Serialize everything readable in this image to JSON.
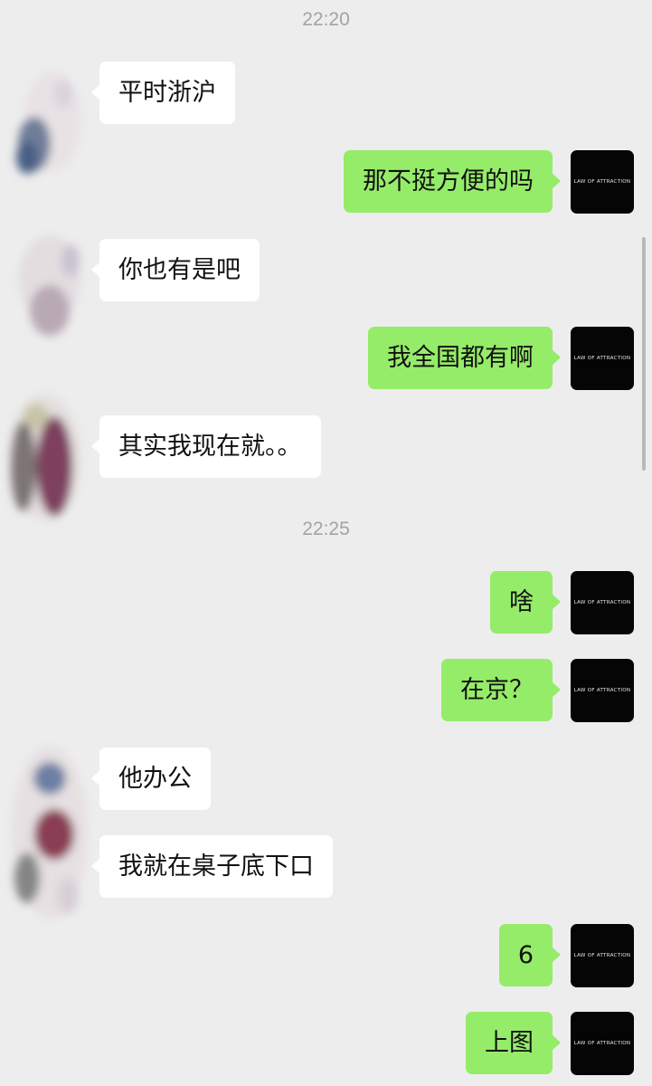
{
  "timestamps": [
    "22:20",
    "22:25"
  ],
  "messages": [
    {
      "side": "left",
      "text": "平时浙沪"
    },
    {
      "side": "right",
      "text": "那不挺方便的吗"
    },
    {
      "side": "left",
      "text": "你也有是吧"
    },
    {
      "side": "right",
      "text": "我全国都有啊"
    },
    {
      "side": "left",
      "text": "其实我现在就。。"
    },
    {
      "side": "right",
      "text": "啥"
    },
    {
      "side": "right",
      "text": "在京？"
    },
    {
      "side": "left",
      "text": "他办公"
    },
    {
      "side": "left",
      "text": "我就在桌子底下口"
    },
    {
      "side": "right",
      "text": "6"
    },
    {
      "side": "right",
      "text": "上图"
    }
  ],
  "my_avatar_text": "LAW OF ATTRACTION",
  "colors": {
    "background": "#ededed",
    "bubble_self": "#95ec69",
    "bubble_peer": "#ffffff",
    "timestamp": "#a3a3a3"
  }
}
